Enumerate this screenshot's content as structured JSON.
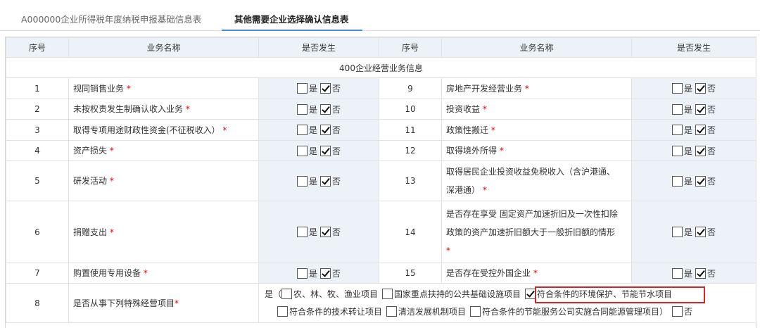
{
  "tabs": [
    {
      "label": "A000000企业所得税年度纳税申报基础信息表"
    },
    {
      "label": "其他需要企业选择确认信息表"
    }
  ],
  "section_title": "400企业经营业务信息",
  "headers": {
    "seq": "序号",
    "name": "业务名称",
    "occur": "是否发生"
  },
  "yes_label": "是",
  "no_label": "否",
  "rows": [
    {
      "left_no": "1",
      "left_name": "视同销售业务",
      "right_no": "9",
      "right_name": "房地产开发经营业务"
    },
    {
      "left_no": "2",
      "left_name": "未按权责发生制确认收入业务",
      "right_no": "10",
      "right_name": "投资收益"
    },
    {
      "left_no": "3",
      "left_name": "取得专项用途财政性资金(不征税收入）",
      "right_no": "11",
      "right_name": "政策性搬迁"
    },
    {
      "left_no": "4",
      "left_name": "资产损失",
      "right_no": "12",
      "right_name": "取得境外所得"
    },
    {
      "left_no": "5",
      "left_name": "研发活动",
      "right_no": "13",
      "right_name_l1": "取得居民企业投资收益免税收入（含沪港通、",
      "right_name_l2": "深港通）"
    },
    {
      "left_no": "6",
      "left_name": "捐赠支出",
      "right_no": "14",
      "right_name_l1": "是否存在享受 固定资产加速折旧及一次性扣除",
      "right_name_l2": "政策的资产加速折旧额大于一般折旧额的情形"
    },
    {
      "left_no": "7",
      "left_name": "购置使用专用设备",
      "right_no": "15",
      "right_name": "是否存在受控外国企业"
    }
  ],
  "row8": {
    "no": "8",
    "name": "是否从事下列特殊经营项目",
    "prefix": "是（",
    "options": [
      {
        "label": "农、林、牧、渔业项目",
        "checked": false
      },
      {
        "label": "国家重点扶持的公共基础设施项目",
        "checked": false
      },
      {
        "label": "符合条件的环境保护、节能节水项目",
        "checked": true
      },
      {
        "label": "符合条件的技术转让项目",
        "checked": false
      },
      {
        "label": "清洁发展机制项目",
        "checked": false
      },
      {
        "label": "符合条件的节能服务公司实施合同能源管理项目",
        "checked": false
      }
    ],
    "suffix": "）",
    "no_label": "否"
  },
  "required_mark": "*",
  "colors": {
    "accent": "#4a90d9",
    "header_bg": "#edf2f9",
    "required": "#e00000",
    "highlight": "#e02020"
  }
}
